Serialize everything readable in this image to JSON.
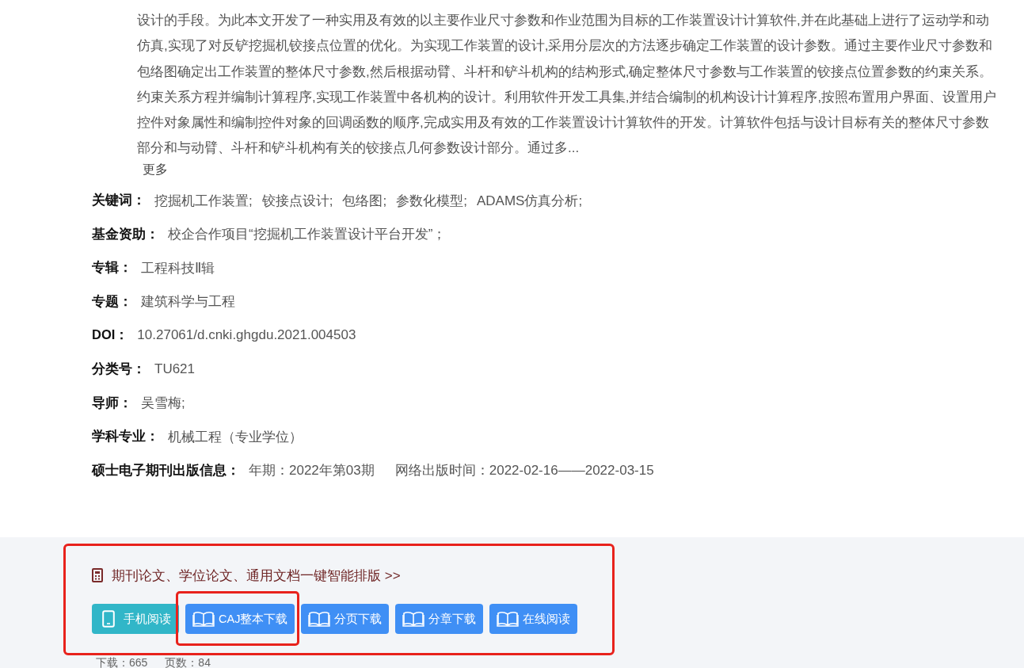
{
  "abstract": {
    "lines": [
      "设计的手段。为此本文开发了一种实用及有效的以主要作业尺寸参数和作业范围为目标的工作装置设计计算软件,并在此基础上进行了运动学和动",
      "仿真,实现了对反铲挖掘机铰接点位置的优化。为实现工作装置的设计,采用分层次的方法逐步确定工作装置的设计参数。通过主要作业尺寸参数和",
      "包络图确定出工作装置的整体尺寸参数,然后根据动臂、斗杆和铲斗机构的结构形式,确定整体尺寸参数与工作装置的铰接点位置参数的约束关系。",
      "约束关系方程并编制计算程序,实现工作装置中各机构的设计。利用软件开发工具集,并结合编制的机构设计计算程序,按照布置用户界面、设置用户",
      "控件对象属性和编制控件对象的回调函数的顺序,完成实用及有效的工作装置设计计算软件的开发。计算软件包括与设计目标有关的整体尺寸参数",
      "部分和与动臂、斗杆和铲斗机构有关的铰接点几何参数设计部分。通过多..."
    ],
    "more_link": "更多"
  },
  "details": [
    {
      "label": "关键词：",
      "kind": "keywords",
      "values": [
        "挖掘机工作装置;",
        "铰接点设计;",
        "包络图;",
        "参数化模型;",
        "ADAMS仿真分析;"
      ]
    },
    {
      "label": "基金资助：",
      "kind": "text",
      "values": [
        "校企合作项目“挖掘机工作装置设计平台开发”；"
      ]
    },
    {
      "label": "专辑：",
      "kind": "text",
      "values": [
        "工程科技Ⅱ辑"
      ]
    },
    {
      "label": "专题：",
      "kind": "text",
      "values": [
        "建筑科学与工程"
      ]
    },
    {
      "label": "DOI：",
      "kind": "text",
      "values": [
        "10.27061/d.cnki.ghgdu.2021.004503"
      ]
    },
    {
      "label": "分类号：",
      "kind": "text",
      "values": [
        "TU621"
      ]
    },
    {
      "label": "导师：",
      "kind": "text",
      "values": [
        "吴雪梅;"
      ]
    },
    {
      "label": "学科专业：",
      "kind": "text",
      "values": [
        "机械工程（专业学位）"
      ]
    },
    {
      "label": "硕士电子期刊出版信息：",
      "kind": "info",
      "values": [
        "年期：2022年第03期",
        "网络出版时间：2022-02-16——2022-03-15"
      ]
    }
  ],
  "actions": {
    "highlighted": true,
    "promo_link": "期刊论文、学位论文、通用文档一键智能排版 >>",
    "buttons": [
      {
        "label": "手机阅读",
        "kind": "phone",
        "color": "#31b6c8",
        "highlighted": false
      },
      {
        "label": "CAJ整本下载",
        "kind": "book",
        "color": "#3f8ff5",
        "highlighted": true
      },
      {
        "label": "分页下载",
        "kind": "book",
        "color": "#3f8ff5",
        "highlighted": false
      },
      {
        "label": "分章下载",
        "kind": "book",
        "color": "#3f8ff5",
        "highlighted": false
      },
      {
        "label": "在线阅读",
        "kind": "book",
        "color": "#3f8ff5",
        "highlighted": false
      }
    ],
    "stats": [
      "下载：665",
      "页数：84"
    ]
  }
}
